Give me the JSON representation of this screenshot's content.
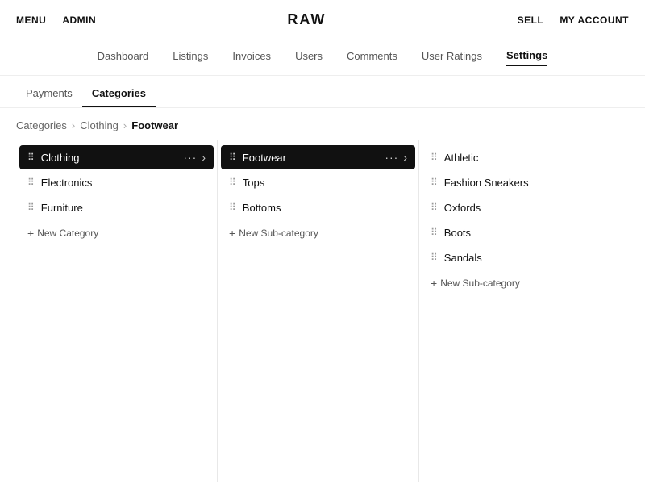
{
  "topbar": {
    "menu": "MENU",
    "admin": "ADMIN",
    "brand": "RAW",
    "sell": "SELL",
    "myaccount": "MY ACCOUNT"
  },
  "mainnav": {
    "items": [
      {
        "label": "Dashboard",
        "active": false
      },
      {
        "label": "Listings",
        "active": false
      },
      {
        "label": "Invoices",
        "active": false
      },
      {
        "label": "Users",
        "active": false
      },
      {
        "label": "Comments",
        "active": false
      },
      {
        "label": "User Ratings",
        "active": false
      },
      {
        "label": "Settings",
        "active": true
      }
    ]
  },
  "settingstabs": {
    "items": [
      {
        "label": "Payments",
        "active": false
      },
      {
        "label": "Categories",
        "active": true
      }
    ]
  },
  "breadcrumb": {
    "root": "Categories",
    "level1": "Clothing",
    "level2": "Footwear"
  },
  "columns": [
    {
      "id": "col1",
      "items": [
        {
          "id": "clothing",
          "label": "Clothing",
          "active": true,
          "hasArrow": true
        },
        {
          "id": "electronics",
          "label": "Electronics",
          "active": false,
          "hasArrow": false
        },
        {
          "id": "furniture",
          "label": "Furniture",
          "active": false,
          "hasArrow": false
        }
      ],
      "newLink": "New Category"
    },
    {
      "id": "col2",
      "items": [
        {
          "id": "footwear",
          "label": "Footwear",
          "active": true,
          "hasArrow": true
        },
        {
          "id": "tops",
          "label": "Tops",
          "active": false,
          "hasArrow": false
        },
        {
          "id": "bottoms",
          "label": "Bottoms",
          "active": false,
          "hasArrow": false
        }
      ],
      "newLink": "New Sub-category"
    },
    {
      "id": "col3",
      "items": [
        {
          "id": "athletic",
          "label": "Athletic",
          "active": false,
          "hasArrow": false
        },
        {
          "id": "fashion-sneakers",
          "label": "Fashion Sneakers",
          "active": false,
          "hasArrow": false
        },
        {
          "id": "oxfords",
          "label": "Oxfords",
          "active": false,
          "hasArrow": false
        },
        {
          "id": "boots",
          "label": "Boots",
          "active": false,
          "hasArrow": false
        },
        {
          "id": "sandals",
          "label": "Sandals",
          "active": false,
          "hasArrow": false
        }
      ],
      "newLink": "New Sub-category"
    }
  ]
}
